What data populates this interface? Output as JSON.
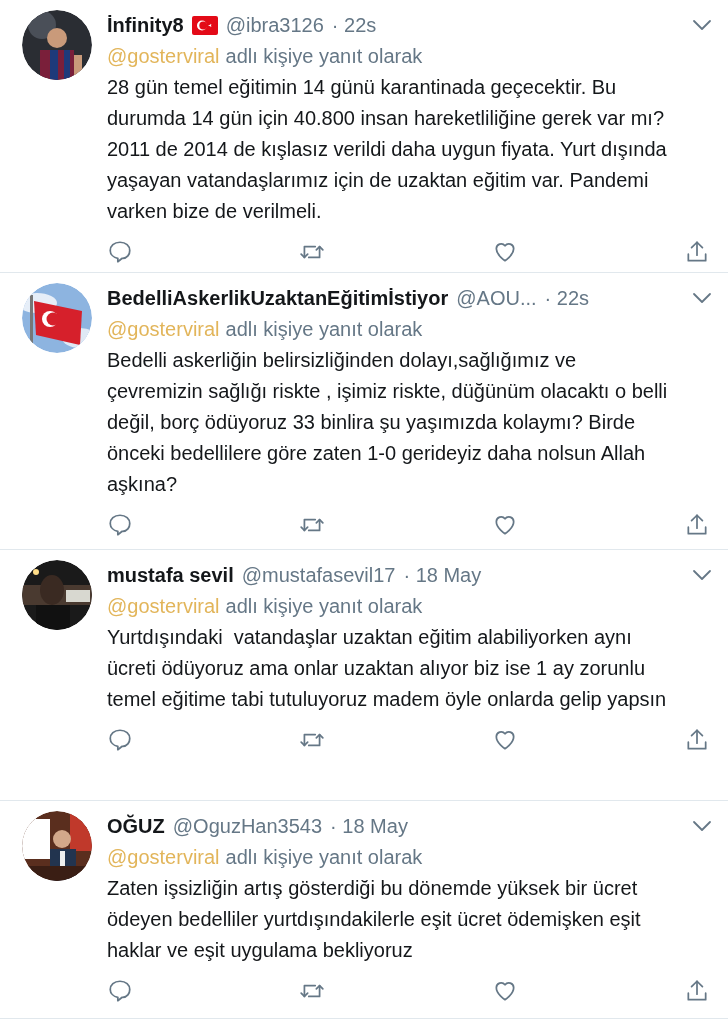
{
  "tweets": [
    {
      "name": "İnfinity8",
      "flag": true,
      "handle": "@ibra3126",
      "time": "· 22s",
      "reply_to": "@gosterviral",
      "reply_label": "adlı kişiye yanıt olarak",
      "text": "28 gün temel eğitimin 14 günü karantinada geçecektir. Bu durumda 14 gün için 40.800 insan hareketliliğine gerek var mı? 2011 de 2014 de kışlasız verildi daha uygun fiyata. Yurt dışında yaşayan vatandaşlarımız için de uzaktan eğitim var. Pandemi varken bize de verilmeli."
    },
    {
      "name": "BedelliAskerlikUzaktanEğitimİstiyor",
      "flag": false,
      "handle": "@AOU...",
      "time": "· 22s",
      "reply_to": "@gosterviral",
      "reply_label": "adlı kişiye yanıt olarak",
      "text": "Bedelli askerliğin belirsizliğinden dolayı,sağlığımız ve çevremizin sağlığı riskte , işimiz riskte, düğünüm olacaktı o belli değil, borç ödüyoruz 33 binlira şu yaşımızda kolaymı? Birde önceki bedellilere göre zaten 1-0 gerideyiz daha nolsun Allah aşkına?"
    },
    {
      "name": "mustafa sevil",
      "flag": false,
      "handle": "@mustafasevil17",
      "time": "· 18 May",
      "reply_to": "@gosterviral",
      "reply_label": "adlı kişiye yanıt olarak",
      "text": "Yurtdışındaki  vatandaşlar uzaktan eğitim alabiliyorken aynı ücreti ödüyoruz ama onlar uzaktan alıyor biz ise 1 ay zorunlu temel eğitime tabi tutuluyoruz madem öyle onlarda gelip yapsın"
    },
    {
      "name": "OĞUZ",
      "flag": false,
      "handle": "@OguzHan3543",
      "time": "· 18 May",
      "reply_to": "@gosterviral",
      "reply_label": "adlı kişiye yanıt olarak",
      "text": "Zaten işsizliğin artış gösterdiği bu dönemde yüksek bir ücret ödeyen bedelliler yurtdışındakilerle eşit ücret ödemişken eşit haklar ve eşit uygulama bekliyoruz"
    }
  ]
}
